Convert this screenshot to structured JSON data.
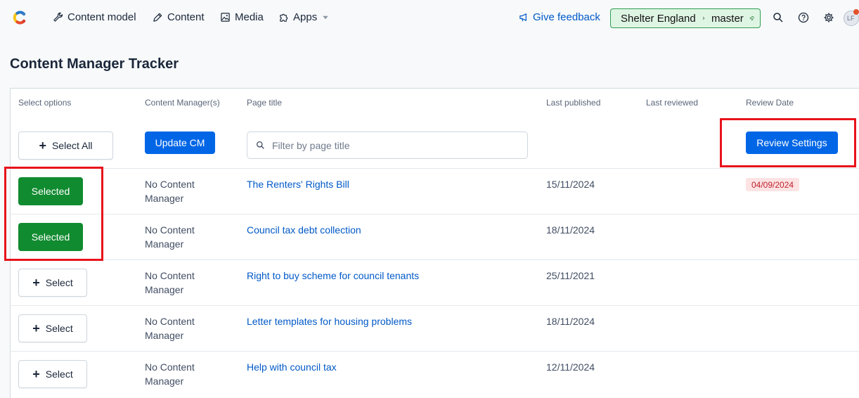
{
  "nav": {
    "content_model": "Content model",
    "content": "Content",
    "media": "Media",
    "apps": "Apps"
  },
  "header_right": {
    "feedback": "Give feedback",
    "space": "Shelter England",
    "environment": "master",
    "avatar_initials": "LF"
  },
  "page": {
    "title": "Content Manager Tracker"
  },
  "table": {
    "headers": {
      "select_options": "Select options",
      "content_managers": "Content Manager(s)",
      "page_title": "Page title",
      "last_published": "Last published",
      "last_reviewed": "Last reviewed",
      "review_date": "Review Date"
    },
    "controls": {
      "select_all": "Select All",
      "update_cm": "Update CM",
      "filter_placeholder": "Filter by page title",
      "review_settings": "Review Settings"
    },
    "rows": [
      {
        "select": "Selected",
        "cm": "No Content Manager",
        "title": "The Renters' Rights Bill",
        "published": "15/11/2024",
        "review_date": "04/09/2024"
      },
      {
        "select": "Selected",
        "cm": "No Content Manager",
        "title": "Council tax debt collection",
        "published": "18/11/2024"
      },
      {
        "select": "Select",
        "cm": "No Content Manager",
        "title": "Right to buy scheme for council tenants",
        "published": "25/11/2021"
      },
      {
        "select": "Select",
        "cm": "No Content Manager",
        "title": "Letter templates for housing problems",
        "published": "18/11/2024"
      },
      {
        "select": "Select",
        "cm": "No Content Manager",
        "title": "Help with council tax",
        "published": "12/11/2024"
      }
    ]
  },
  "colors": {
    "primary": "#0066e6",
    "selected_green": "#118b30",
    "link": "#0059c8",
    "overdue_bg": "#fde3e3",
    "overdue_text": "#bd212b",
    "annotation_red": "#e8131b"
  }
}
